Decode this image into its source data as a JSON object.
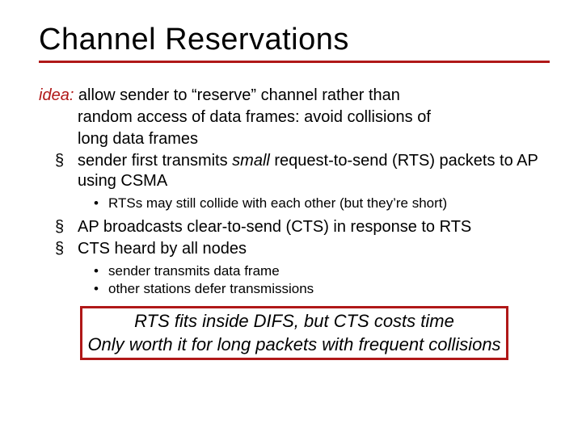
{
  "title": "Channel Reservations",
  "idea": {
    "label": "idea:",
    "text_first": "  allow sender to “reserve” channel rather than",
    "cont1": "random access of data frames: avoid  collisions of",
    "cont2": "long  data frames"
  },
  "bullets": {
    "b1_pre": "sender first transmits ",
    "b1_em": "small",
    "b1_post": " request-to-send (RTS) packets to AP using CSMA",
    "b1_sub1": "RTSs may still collide with each other (but they’re short)",
    "b2": "AP broadcasts clear-to-send (CTS) in response to RTS",
    "b3": "CTS heard by all nodes",
    "b3_sub1": "sender transmits data frame",
    "b3_sub2": "other stations defer transmissions"
  },
  "callout": {
    "line1": "RTS fits inside DIFS, but CTS costs time",
    "line2": "Only worth it for long packets with frequent collisions"
  }
}
